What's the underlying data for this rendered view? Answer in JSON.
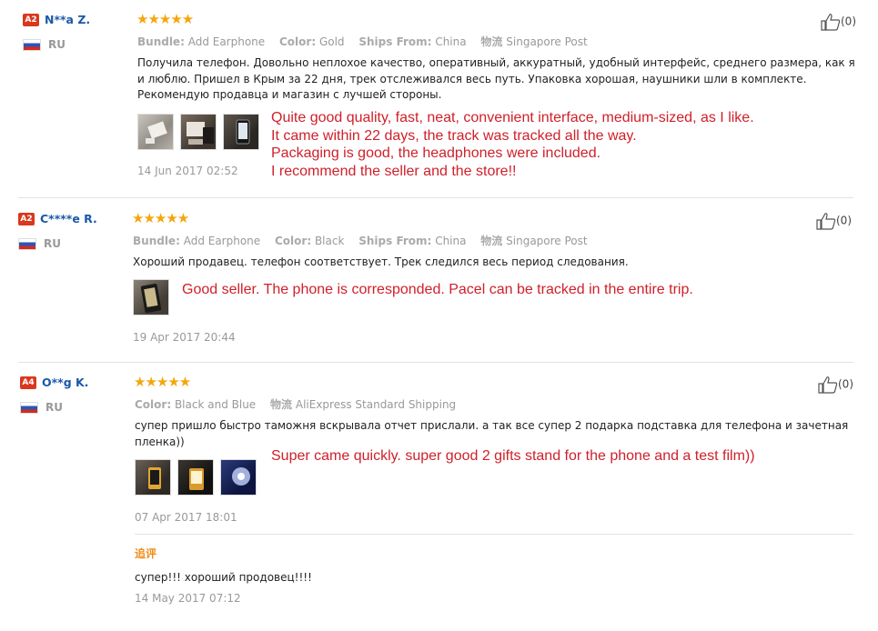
{
  "reviews": [
    {
      "level": "A2",
      "name": "N**a Z.",
      "country": "RU",
      "stars": "★★★★★",
      "bundle_label": "Bundle:",
      "bundle_value": "Add Earphone",
      "color_label": "Color:",
      "color_value": "Gold",
      "ships_label": "Ships From:",
      "ships_value": "China",
      "shipping_label": "物流",
      "shipping_value": "Singapore Post",
      "text": "Получила телефон. Довольно неплохое качество, оперативный, аккуратный, удобный интерфейс, среднего размера, как я и люблю. Пришел в Крым за 22 дня, трек отслеживался весь путь. Упаковка хорошая, наушники шли в комплекте. Рекомендую продавца и магазин с лучшей стороны.",
      "translation": [
        "Quite good quality, fast, neat, convenient interface, medium-sized, as I like.",
        "It came within 22 days, the track was tracked all the way.",
        "Packaging is good, the headphones were included.",
        "I recommend the seller and the store!!"
      ],
      "date": "14 Jun 2017 02:52",
      "helpful": "(0)"
    },
    {
      "level": "A2",
      "name": "C****e R.",
      "country": "RU",
      "stars": "★★★★★",
      "bundle_label": "Bundle:",
      "bundle_value": "Add Earphone",
      "color_label": "Color:",
      "color_value": "Black",
      "ships_label": "Ships From:",
      "ships_value": "China",
      "shipping_label": "物流",
      "shipping_value": "Singapore Post",
      "text": "Хороший продавец. телефон соответствует. Трек следился весь период следования.",
      "translation": [
        "Good seller. The phone is corresponded. Pacel can be tracked in the entire trip."
      ],
      "date": "19 Apr 2017 20:44",
      "helpful": "(0)"
    },
    {
      "level": "A4",
      "name": "O**g K.",
      "country": "RU",
      "stars": "★★★★★",
      "color_label": "Color:",
      "color_value": "Black and Blue",
      "shipping_label": "物流",
      "shipping_value": "AliExpress Standard Shipping",
      "text": "супер пришло быстро таможня вскрывала отчет прислали. а так все супер 2 подарка подставка для телефона и зачетная пленка))",
      "translation": [
        "Super came quickly. super good 2 gifts stand for the phone and a test film))"
      ],
      "date": "07 Apr 2017 18:01",
      "helpful": "(0)",
      "followup_label": "追评",
      "followup_text": "супер!!! хороший продовец!!!!",
      "followup_date": "14 May 2017 07:12"
    }
  ]
}
